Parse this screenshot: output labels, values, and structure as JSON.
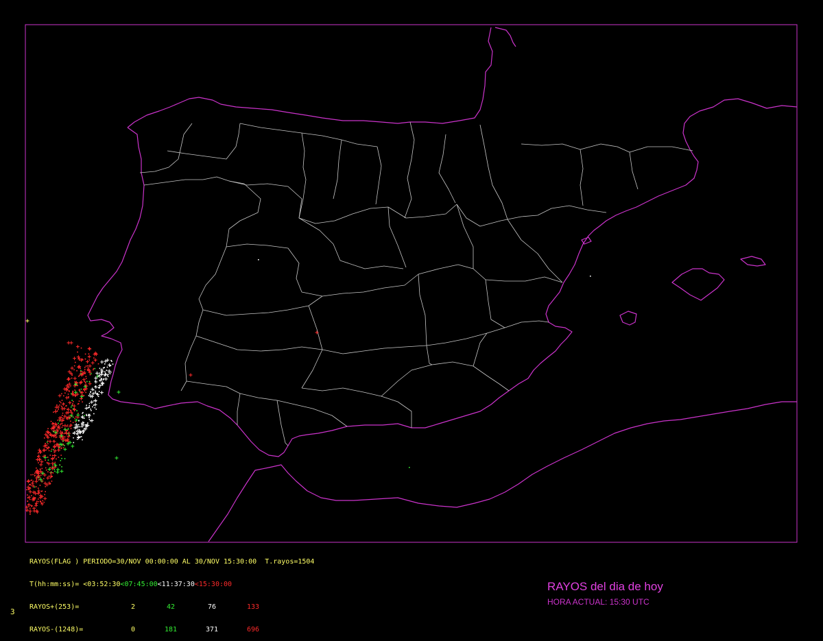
{
  "header_line": {
    "label": "RAYOS(FLAG )",
    "periodo": "PERIODO=30/NOV 00:00:00 AL 30/NOV 15:30:00",
    "total": "T.rayos=1504"
  },
  "time_row": {
    "label": "T(hh:mm:ss)=",
    "t1": "<03:52:30",
    "t2": "<07:45:00",
    "t3": "<11:37:30",
    "t4": "<15:30:00"
  },
  "pos_row": {
    "label": "RAYOS+(253)=",
    "v1": "2",
    "v2": "42",
    "v3": "76",
    "v4": "133"
  },
  "neg_row": {
    "label": "RAYOS-(1248)=",
    "v1": "0",
    "v2": "181",
    "v3": "371",
    "v4": "696"
  },
  "legend": {
    "title": "RAYOS del dia de hoy",
    "time": "HORA ACTUAL: 15:30 UTC"
  },
  "corner_number": "3",
  "colors": {
    "background": "#000000",
    "frame": "#cc33cc",
    "coast": "#cc33cc",
    "borders": "#c8c8c8",
    "period1": "#ffff66",
    "period2": "#33ee33",
    "period3": "#ffffff",
    "period4": "#ff2a2a"
  }
}
